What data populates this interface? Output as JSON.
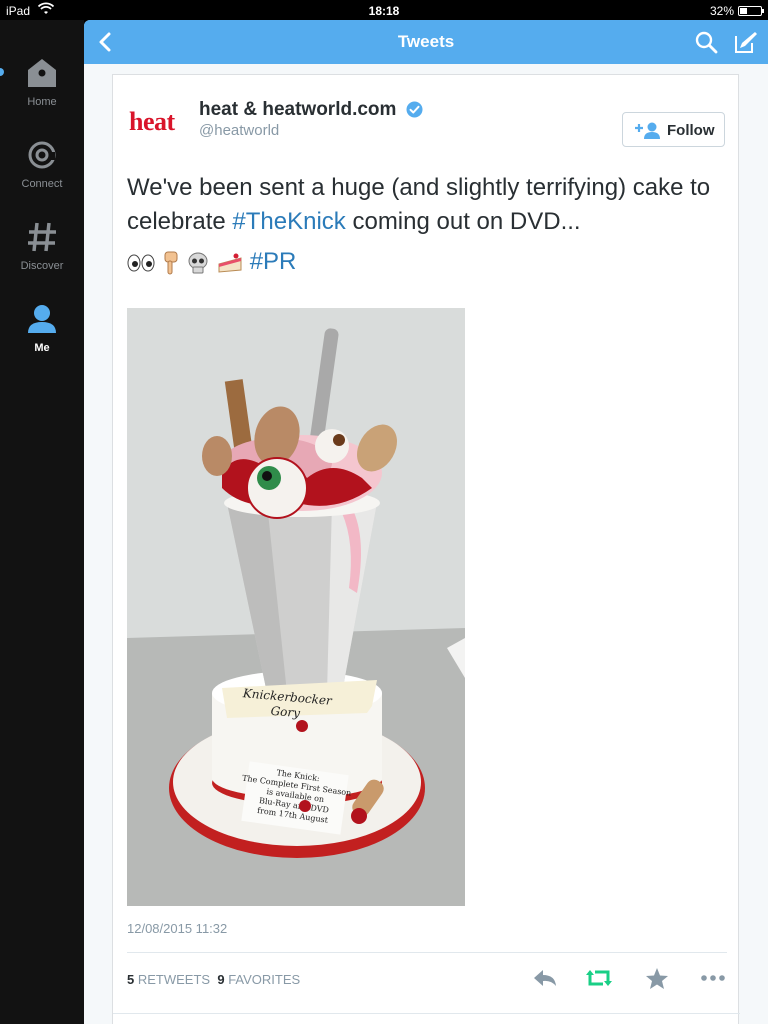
{
  "status_bar": {
    "carrier": "iPad",
    "time": "18:18",
    "battery": "32%"
  },
  "sidebar": {
    "items": [
      {
        "label": "Home",
        "icon": "home-icon"
      },
      {
        "label": "Connect",
        "icon": "at-icon"
      },
      {
        "label": "Discover",
        "icon": "hash-icon"
      },
      {
        "label": "Me",
        "icon": "person-icon",
        "active": true
      }
    ]
  },
  "topbar": {
    "title": "Tweets"
  },
  "tweet": {
    "logo_text": "heat",
    "name": "heat & heatworld.com",
    "handle": "@heatworld",
    "follow_label": "Follow",
    "text_prefix": "We've been sent a huge (and slightly terrifying) cake to celebrate ",
    "hashtag_1": "#TheKnick",
    "text_suffix": " coming out on DVD...",
    "emojis": [
      "eyes-icon",
      "point-down-icon",
      "skull-icon",
      "cake-icon"
    ],
    "hashtag_2": "#PR",
    "photo": {
      "alt": "Cake styled as a milkshake glass with eyeballs and fingers",
      "banner_line1": "Knickerbocker",
      "banner_line2": "Gory",
      "plaque_lines": [
        "The Knick:",
        "The Complete First Season",
        "is available on",
        "Blu-Ray and DVD",
        "from 17th August"
      ]
    },
    "date": "12/08/2015 11:32",
    "retweets": "5",
    "retweets_label": "RETWEETS",
    "favorites": "9",
    "favorites_label": "FAVORITES"
  },
  "colors": {
    "twitter_blue": "#55acee",
    "retweet_green": "#19cf86",
    "heat_red": "#d9142a"
  }
}
